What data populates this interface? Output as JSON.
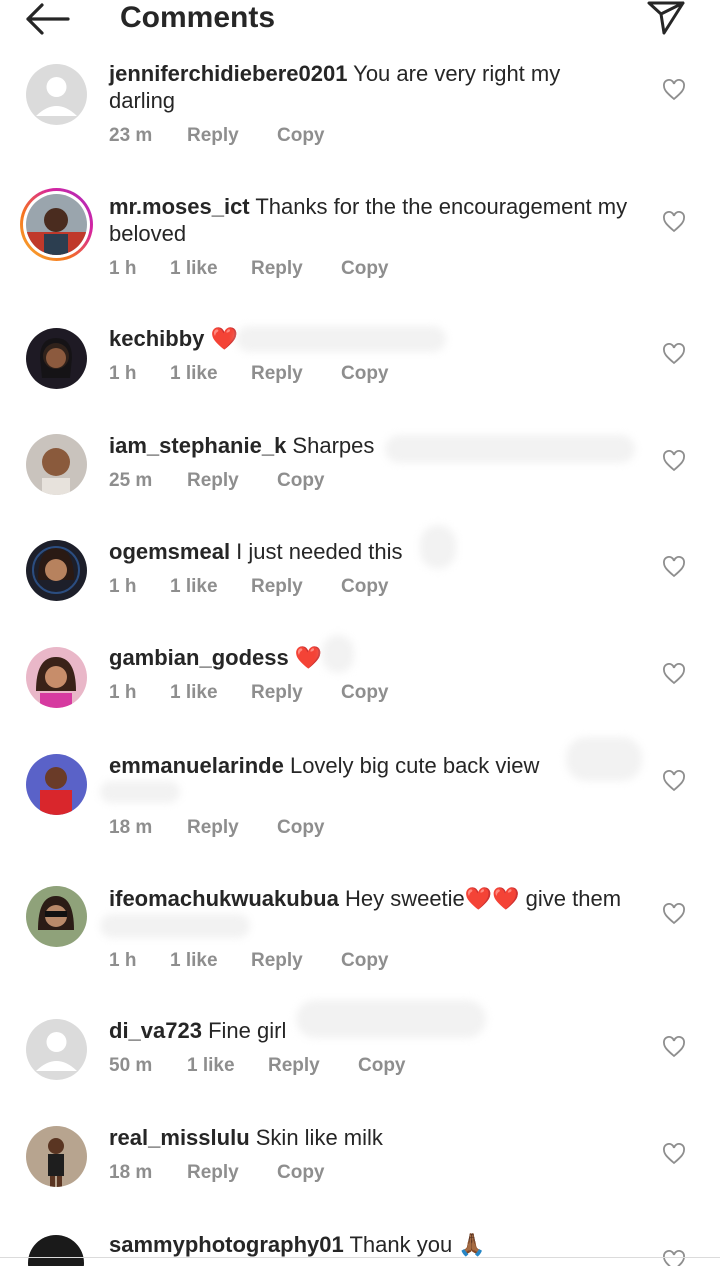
{
  "header": {
    "title": "Comments",
    "back_icon": "arrow-left-icon",
    "send_icon": "paper-plane-icon"
  },
  "colors": {
    "heart_red": "#ed4956",
    "meta_gray": "#8e8e8e",
    "text": "#262626"
  },
  "labels": {
    "reply": "Reply",
    "copy": "Copy"
  },
  "comments": [
    {
      "username": "jenniferchidiebere0201",
      "text": " You are very right my darling",
      "time": "23 m",
      "likes": ""
    },
    {
      "username": "mr.moses_ict",
      "text": " Thanks for the the encouragement my beloved",
      "time": "1 h",
      "likes": "1 like"
    },
    {
      "username": "kechibby",
      "text": " ❤️",
      "time": "1 h",
      "likes": "1 like"
    },
    {
      "username": "iam_stephanie_k",
      "text": " Sharpes",
      "time": "25 m",
      "likes": ""
    },
    {
      "username": "ogemsmeal",
      "text": " I just needed this",
      "time": "1 h",
      "likes": "1 like"
    },
    {
      "username": "gambian_godess",
      "text": " ❤️",
      "time": "1 h",
      "likes": "1 like"
    },
    {
      "username": "emmanuelarinde",
      "text": " Lovely big cute back view",
      "time": "18 m",
      "likes": ""
    },
    {
      "username": "ifeomachukwuakubua",
      "text": " Hey sweetie❤️❤️ give them",
      "time": "1 h",
      "likes": "1 like"
    },
    {
      "username": "di_va723",
      "text": " Fine girl",
      "time": "50 m",
      "likes": "1 like"
    },
    {
      "username": "real_misslulu",
      "text": " Skin like milk",
      "time": "18 m",
      "likes": ""
    },
    {
      "username": "sammyphotography01",
      "text": " Thank you 🙏🏾",
      "time": "",
      "likes": ""
    }
  ]
}
